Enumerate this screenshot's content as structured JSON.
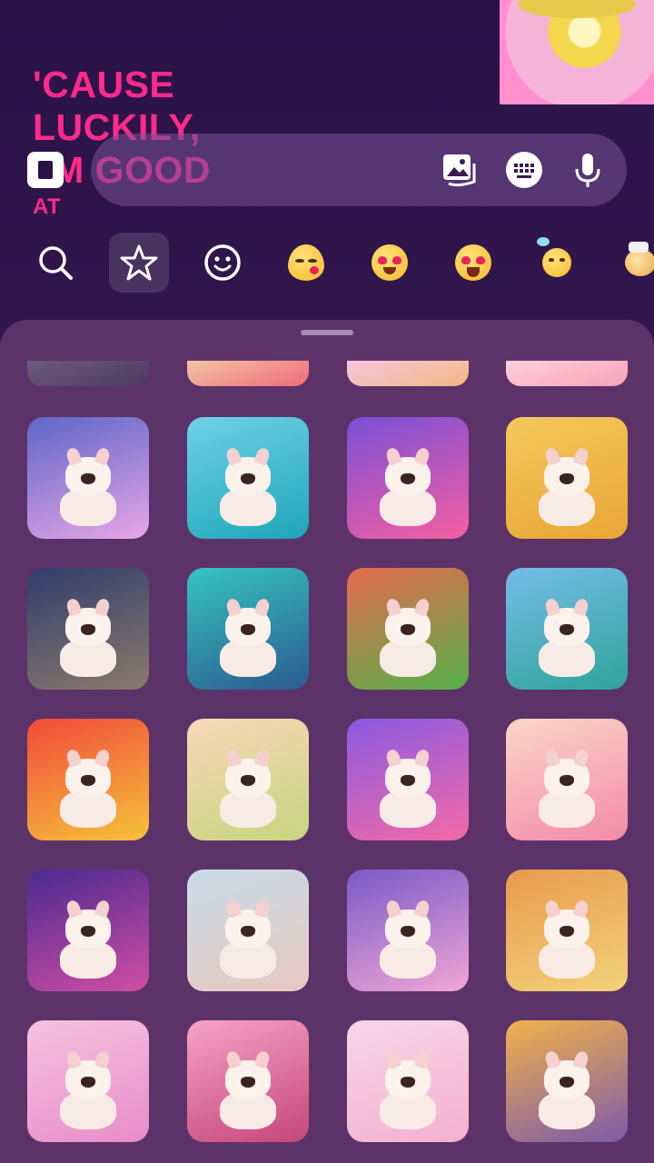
{
  "story": {
    "lyric_lines": [
      "'CAUSE",
      "LUCKILY,",
      "I'M GOOD",
      "AT"
    ]
  },
  "composer": {
    "icons": [
      "camera-icon",
      "gallery-icon",
      "keyboard-icon",
      "microphone-icon"
    ]
  },
  "tabs": [
    {
      "name": "search-icon",
      "active": false
    },
    {
      "name": "star-icon",
      "active": true
    },
    {
      "name": "smiley-icon",
      "active": false
    },
    {
      "name": "kiss-emoji-icon",
      "active": false
    },
    {
      "name": "heart-eyes-emoji-icon",
      "active": false
    },
    {
      "name": "heart-eyes-emoji-icon",
      "active": false
    },
    {
      "name": "sunbathing-emoji-icon",
      "active": false
    },
    {
      "name": "party-emoji-icon",
      "active": false
    }
  ],
  "colors": {
    "background": "#2a1247",
    "sheet": "#5c3369",
    "lyric": "#ff2a8a",
    "accent_pink": "#f6b3d8",
    "accent_yellow": "#f4d74c"
  },
  "stickers": [
    {
      "theme": "partial",
      "bg": [
        "#6c5a7a",
        "#4e3a62"
      ]
    },
    {
      "theme": "partial",
      "bg": [
        "#f3c4a4",
        "#f06a7a"
      ]
    },
    {
      "theme": "partial",
      "bg": [
        "#f7c6e0",
        "#f2b880"
      ]
    },
    {
      "theme": "partial",
      "bg": [
        "#ffd0dc",
        "#f7a2b8"
      ]
    },
    {
      "theme": "rainbow-dance",
      "bg": [
        "#5d66c8",
        "#e7a6e6"
      ]
    },
    {
      "theme": "dolphin-beach",
      "bg": [
        "#6fd1e8",
        "#1ea6b8"
      ]
    },
    {
      "theme": "candy-party",
      "bg": [
        "#7a4fd6",
        "#f55fa2"
      ]
    },
    {
      "theme": "golden-sparkle",
      "bg": [
        "#f4c85c",
        "#e9a634"
      ]
    },
    {
      "theme": "banana-friends",
      "bg": [
        "#2f3d6b",
        "#8c7a6c"
      ]
    },
    {
      "theme": "coral-reef",
      "bg": [
        "#36c4c1",
        "#2b5b8f"
      ]
    },
    {
      "theme": "soccer-stadium",
      "bg": [
        "#e66a4d",
        "#55b04a"
      ]
    },
    {
      "theme": "hawaiian-surf",
      "bg": [
        "#74bde8",
        "#2fa39a"
      ]
    },
    {
      "theme": "rainbow-ladybug",
      "bg": [
        "#f14a3a",
        "#f6c23a"
      ]
    },
    {
      "theme": "bunny-meadow",
      "bg": [
        "#f8d7b8",
        "#c7d67e"
      ]
    },
    {
      "theme": "candy-party",
      "bg": [
        "#8a5ae0",
        "#f46aa6"
      ]
    },
    {
      "theme": "lollipop-land",
      "bg": [
        "#fbd6c8",
        "#f48aa8"
      ]
    },
    {
      "theme": "starry-galaxy",
      "bg": [
        "#4a2a8f",
        "#d04ea5"
      ]
    },
    {
      "theme": "close-up-smile",
      "bg": [
        "#c8dbe8",
        "#e8c9c0"
      ]
    },
    {
      "theme": "big-belly",
      "bg": [
        "#7a5ac8",
        "#f0a6d4"
      ]
    },
    {
      "theme": "dolphin-sunset",
      "bg": [
        "#e99a4e",
        "#f2d27a"
      ]
    },
    {
      "theme": "pink-rainbow",
      "bg": [
        "#f6c2e0",
        "#e88cc8"
      ]
    },
    {
      "theme": "cherry-blossom",
      "bg": [
        "#f6a2c6",
        "#c5467a"
      ]
    },
    {
      "theme": "ballet-clouds",
      "bg": [
        "#f7d6e6",
        "#f4b0d0"
      ]
    },
    {
      "theme": "carnival-lights",
      "bg": [
        "#f2b24a",
        "#7d5aa8"
      ]
    }
  ]
}
